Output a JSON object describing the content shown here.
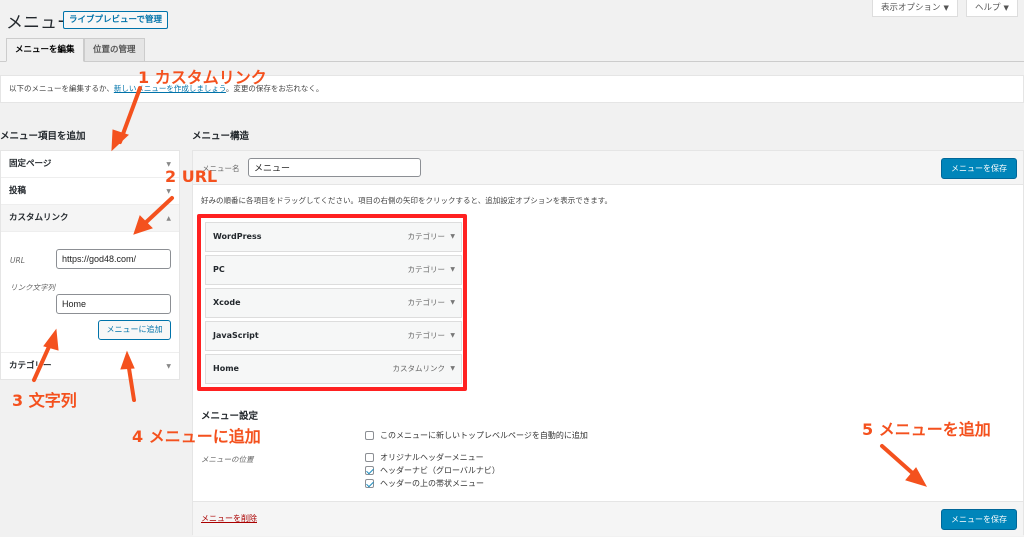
{
  "header": {
    "title": "メニュー",
    "live_preview": "ライブプレビューで管理",
    "screen_options": "表示オプション",
    "help": "ヘルプ",
    "dropdown_glyph": "▼"
  },
  "tabs": [
    {
      "label": "メニューを編集"
    },
    {
      "label": "位置の管理"
    }
  ],
  "notice": {
    "before": "以下のメニューを編集するか、",
    "link": "新しいメニューを作成しましょう",
    "after": "。変更の保存をお忘れなく。"
  },
  "sidebar": {
    "heading": "メニュー項目を追加",
    "items": [
      {
        "label": "固定ページ"
      },
      {
        "label": "投稿"
      },
      {
        "label": "カスタムリンク"
      },
      {
        "label": "カテゴリー"
      }
    ],
    "custom_link": {
      "url_label": "URL",
      "url_value": "https://god48.com/",
      "text_label": "リンク文字列",
      "text_value": "Home",
      "add_button": "メニューに追加"
    }
  },
  "structure": {
    "heading": "メニュー構造",
    "name_label": "メニュー名",
    "name_value": "メニュー",
    "save_button": "メニューを保存",
    "instructions": "好みの順番に各項目をドラッグしてください。項目の右側の矢印をクリックすると、追加設定オプションを表示できます。",
    "items": [
      {
        "title": "WordPress",
        "type": "カテゴリー"
      },
      {
        "title": "PC",
        "type": "カテゴリー"
      },
      {
        "title": "Xcode",
        "type": "カテゴリー"
      },
      {
        "title": "JavaScript",
        "type": "カテゴリー"
      },
      {
        "title": "Home",
        "type": "カスタムリンク"
      }
    ],
    "settings": {
      "heading": "メニュー設定",
      "auto_add": "このメニューに新しいトップレベルページを自動的に追加",
      "location_label": "メニューの位置",
      "locations": [
        {
          "label": "オリジナルヘッダーメニュー",
          "checked": false
        },
        {
          "label": "ヘッダーナビ（グローバルナビ）",
          "checked": true
        },
        {
          "label": "ヘッダーの上の帯状メニュー",
          "checked": true
        }
      ]
    },
    "delete_link": "メニューを削除"
  },
  "annotations": {
    "a1": "1 カスタムリンク",
    "a2": "2 URL",
    "a3": "3 文字列",
    "a4": "4 メニューに追加",
    "a5": "5 メニューを追加"
  },
  "colors": {
    "accent": "#0073aa",
    "primary_button": "#0085ba",
    "annotation": "#f4511e",
    "highlight_box": "#ff2121"
  }
}
